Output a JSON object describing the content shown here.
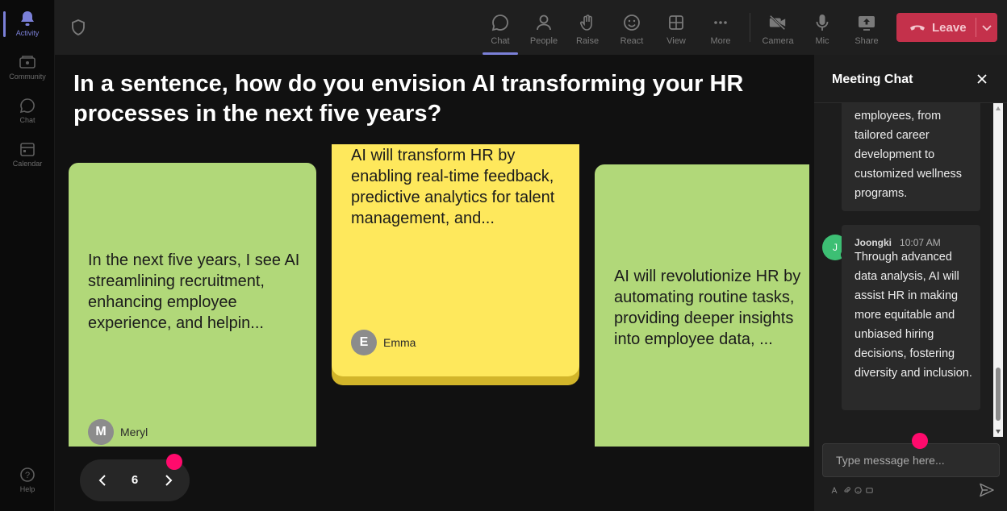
{
  "rail": {
    "items": [
      {
        "label": "Activity",
        "icon": "bell-icon",
        "active": true
      },
      {
        "label": "Community",
        "icon": "community-icon",
        "active": false
      },
      {
        "label": "Chat",
        "icon": "chat-icon",
        "active": false
      },
      {
        "label": "Calendar",
        "icon": "calendar-icon",
        "active": false
      },
      {
        "label": "Help",
        "icon": "help-icon",
        "active": false
      }
    ]
  },
  "toolbar": {
    "chat": "Chat",
    "people": "People",
    "raise": "Raise",
    "react": "React",
    "view": "View",
    "more": "More",
    "camera": "Camera",
    "mic": "Mic",
    "share": "Share",
    "leave": "Leave"
  },
  "stage": {
    "question": "In a sentence, how do you envision AI transforming your HR processes in the next five years?",
    "cards": [
      {
        "text": "In the next five years, I see AI streamlining recruitment, enhancing employee experience, and helpin...",
        "author": "Meryl",
        "initial": "M",
        "color": "#b1d879"
      },
      {
        "text": "AI will transform HR by enabling real-time feedback, predictive analytics for talent management, and...",
        "author": "Emma",
        "initial": "E",
        "color": "#fee85c"
      },
      {
        "text": "AI will revolutionize HR by automating routine tasks, providing deeper insights into employee data, ...",
        "color": "#b1d879"
      }
    ],
    "pager": {
      "page": "6"
    }
  },
  "chat": {
    "title": "Meeting Chat",
    "messages": [
      {
        "text": "employees, from tailored career development to customized wellness programs."
      },
      {
        "author": "Joongki",
        "initial": "J",
        "time": "10:07 AM",
        "text": "Through advanced data analysis, AI will assist HR in making more equitable and unbiased hiring decisions, fostering diversity and inclusion."
      }
    ],
    "input_placeholder": "Type message here..."
  },
  "colors": {
    "accent": "#7b80d8",
    "leave": "#c4314b",
    "card_green": "#b1d879",
    "card_yellow": "#fee85c",
    "click_marker": "#ff0a6c",
    "avatar_j": "#3dbf74"
  }
}
